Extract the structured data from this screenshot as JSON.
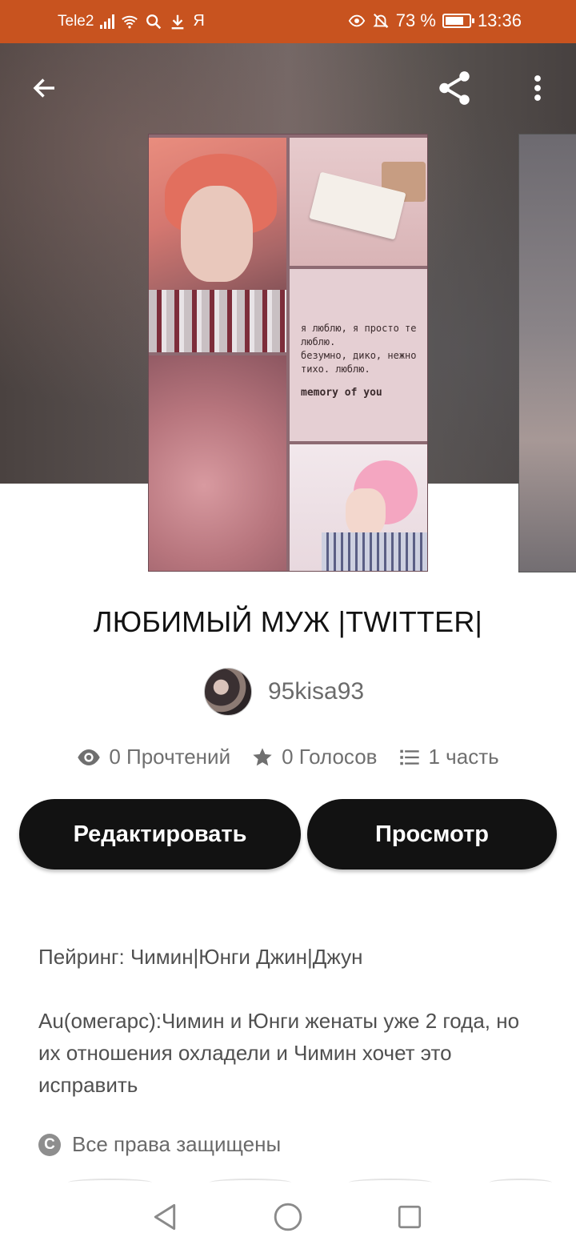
{
  "status_bar": {
    "carrier": "Tele2",
    "extra": "Я",
    "battery_percent": "73 %",
    "time": "13:36"
  },
  "header": {
    "back_icon": "arrow-left-icon",
    "share_icon": "share-icon",
    "more_icon": "more-vertical-icon"
  },
  "story": {
    "title": "ЛЮБИМЫЙ МУЖ |TWITTER|",
    "cover_text": "я люблю, я просто те\nлюблю.\nбезумно, дико, нежно\nтихо. люблю.",
    "cover_text_bottom": "memory of you",
    "author": "95kisa93",
    "stats": {
      "reads": "0 Прочтений",
      "votes": "0 Голосов",
      "parts": "1 часть"
    }
  },
  "actions": {
    "edit_label": "Редактировать",
    "view_label": "Просмотр"
  },
  "description": {
    "line1": "Пейринг: Чимин|Юнги Джин|Джун",
    "line2": "Au(омегарс):Чимин и Юнги женаты уже 2 года, но их отношения охладели и Чимин хочет это исправить"
  },
  "copyright": "Все права защищены",
  "colors": {
    "status_bar": "#c8531f",
    "button_bg": "#121212",
    "button_text": "#ffffff"
  }
}
